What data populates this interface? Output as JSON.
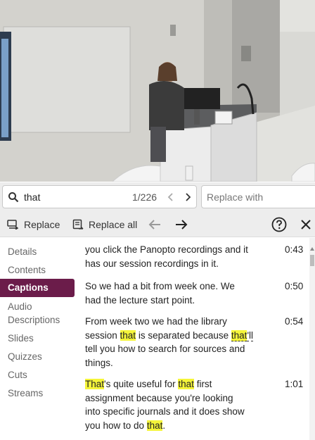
{
  "search": {
    "query": "that",
    "count": "1/226",
    "replace_placeholder": "Replace with"
  },
  "toolbar": {
    "replace_label": "Replace",
    "replace_all_label": "Replace all"
  },
  "sidebar": {
    "items": [
      {
        "label": "Details"
      },
      {
        "label": "Contents"
      },
      {
        "label": "Captions",
        "active": true
      },
      {
        "label": "Audio"
      },
      {
        "label": "Descriptions"
      },
      {
        "label": "Slides"
      },
      {
        "label": "Quizzes"
      },
      {
        "label": "Cuts"
      },
      {
        "label": "Streams"
      }
    ]
  },
  "captions": [
    {
      "time": "0:43",
      "lines": [
        "you click the Panopto recordings and it",
        "has our session recordings in it."
      ]
    },
    {
      "time": "0:50",
      "lines": [
        "So we had a bit from week one. We",
        "had the lecture start point."
      ]
    },
    {
      "time": "0:54",
      "parts": [
        "From week two we had the library",
        "session ",
        "that",
        " is separated because ",
        "that",
        "'ll",
        "tell you how to search for sources and",
        "things."
      ]
    },
    {
      "time": "1:01",
      "parts": [
        "That",
        "'s quite useful for ",
        "that",
        " first",
        "assignment because you're looking",
        "into specific journals and it does show",
        "you how to do ",
        "that",
        "."
      ]
    }
  ],
  "colors": {
    "accent": "#6b1c4a",
    "highlight": "#f5f53a"
  }
}
